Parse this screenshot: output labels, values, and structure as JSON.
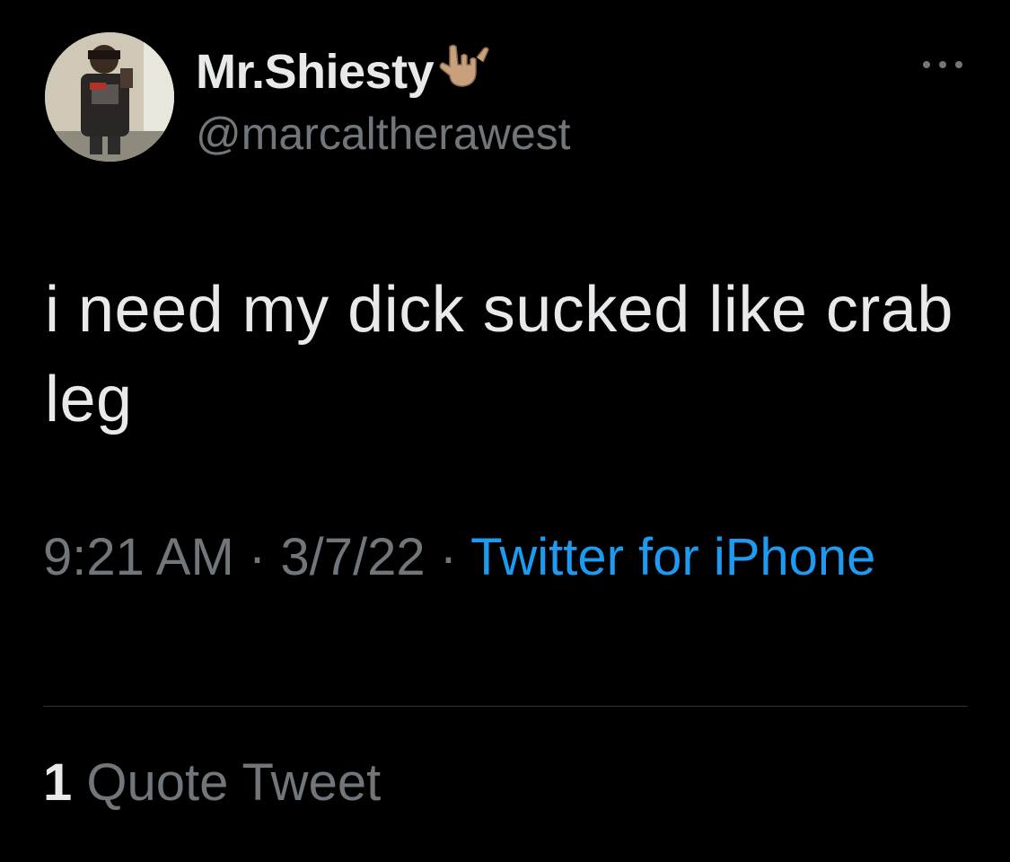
{
  "author": {
    "display_name": "Mr.Shiesty",
    "name_emoji": "rock-on-hand-emoji",
    "handle": "@marcaltherawest",
    "avatar": "profile-photo"
  },
  "tweet": {
    "text": "i need my dick sucked like crab leg",
    "time": "9:21 AM",
    "separator": " · ",
    "date": "3/7/22",
    "source": "Twitter for iPhone"
  },
  "stats": {
    "quote_count": "1",
    "quote_label": "Quote Tweet"
  },
  "icons": {
    "more": "more-horizontal-icon"
  },
  "colors": {
    "background": "#000000",
    "primary_text": "#e7e9ea",
    "secondary_text": "#71767b",
    "link": "#1d9bf0",
    "divider": "#2f3336"
  }
}
